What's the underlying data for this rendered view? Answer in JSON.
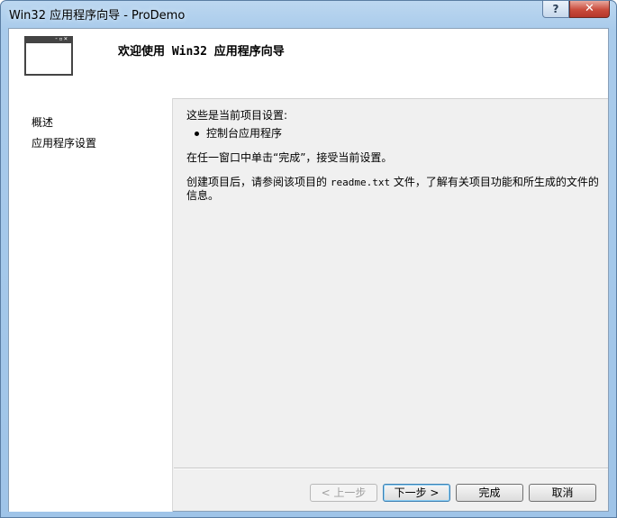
{
  "window": {
    "title": "Win32 应用程序向导 - ProDemo",
    "help_label": "?",
    "close_label": "✕"
  },
  "header": {
    "title": "欢迎使用 Win32 应用程序向导",
    "icon": "window-icon"
  },
  "nav": {
    "items": [
      {
        "label": "概述"
      },
      {
        "label": "应用程序设置"
      }
    ]
  },
  "content": {
    "line1": "这些是当前项目设置:",
    "bullet1": "控制台应用程序",
    "line2": "在任一窗口中单击“完成”，接受当前设置。",
    "line3_a": "创建项目后，请参阅该项目的",
    "line3_file": "readme.txt",
    "line3_b": "文件，了解有关项目功能和所生成的文件的信息。"
  },
  "buttons": {
    "prev": "< 上一步",
    "next": "下一步 >",
    "finish": "完成",
    "cancel": "取消"
  }
}
